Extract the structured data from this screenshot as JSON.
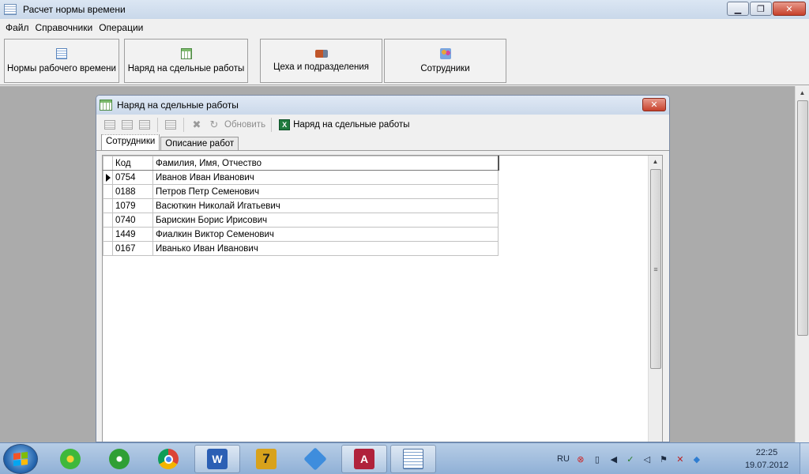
{
  "window": {
    "title": "Расчет нормы времени"
  },
  "menu": [
    "Файл",
    "Справочники",
    "Операции"
  ],
  "main_buttons": [
    {
      "label": "Нормы рабочего времени",
      "icon": "grid-icon"
    },
    {
      "label": "Наряд на сдельные работы",
      "icon": "table-icon"
    },
    {
      "label": "Цеха и подразделения",
      "icon": "truck-icon"
    },
    {
      "label": "Сотрудники",
      "icon": "people-icon"
    }
  ],
  "child_window": {
    "title": "Наряд на сдельные работы",
    "toolbar": {
      "refresh_label": "Обновить",
      "report_label": "Наряд на сдельные работы"
    },
    "tabs": [
      {
        "label": "Сотрудники",
        "active": true
      },
      {
        "label": "Описание работ",
        "active": false
      }
    ],
    "grid": {
      "columns": [
        "Код",
        "Фамилия, Имя, Отчество"
      ],
      "rows": [
        {
          "code": "0754",
          "name": "Иванов Иван Иванович",
          "current": true
        },
        {
          "code": "0188",
          "name": "Петров Петр Семенович"
        },
        {
          "code": "1079",
          "name": "Васюткин Николай Игатьевич"
        },
        {
          "code": "0740",
          "name": "Барискин Борис Ирисович"
        },
        {
          "code": "1449",
          "name": "Фиалкин Виктор Семенович"
        },
        {
          "code": "0167",
          "name": "Иванько Иван Иванович"
        }
      ]
    }
  },
  "taskbar": {
    "apps": [
      "icq",
      "network",
      "chrome",
      "word",
      "7zip",
      "dropbox",
      "access",
      "table-app"
    ],
    "tray": {
      "lang": "RU"
    },
    "clock": {
      "time": "22:25",
      "date": "19.07.2012"
    }
  }
}
